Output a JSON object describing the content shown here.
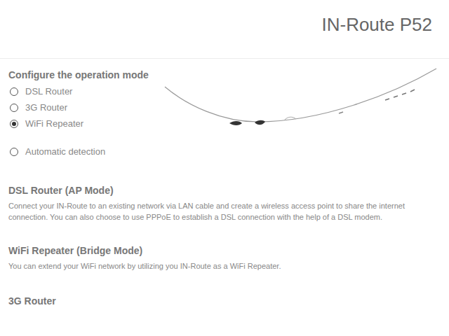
{
  "header": {
    "title": "IN-Route P52"
  },
  "mode_section": {
    "title": "Configure the operation mode",
    "options": [
      {
        "label": "DSL Router",
        "selected": false
      },
      {
        "label": "3G Router",
        "selected": false
      },
      {
        "label": "WiFi Repeater",
        "selected": true
      },
      {
        "label": "Automatic detection",
        "selected": false
      }
    ]
  },
  "descriptions": [
    {
      "title": "DSL Router (AP Mode)",
      "text": "Connect your IN-Route to an existing network via LAN cable and create a wireless access point to share the internet connection. You can also choose to use PPPoE to establish a DSL connection with the help of a DSL modem."
    },
    {
      "title": "WiFi Repeater (Bridge Mode)",
      "text": "You can extend your WiFi network by utilizing you IN-Route as a WiFi Repeater."
    },
    {
      "title": "3G Router"
    }
  ]
}
